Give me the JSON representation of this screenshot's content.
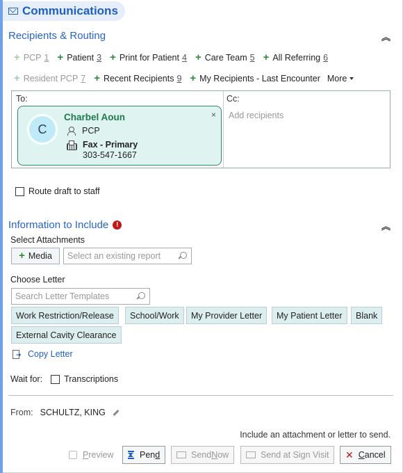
{
  "header": {
    "title": "Communications",
    "icon": "envelope-icon"
  },
  "recipients": {
    "section_title": "Recipients & Routing",
    "row1": [
      {
        "label": "PCP",
        "shortcut": "1",
        "enabled": false
      },
      {
        "label": "Patient",
        "shortcut": "3",
        "enabled": true
      },
      {
        "label": "Print for Patient",
        "shortcut": "4",
        "enabled": true
      },
      {
        "label": "Care Team",
        "shortcut": "5",
        "enabled": true
      },
      {
        "label": "All Referring",
        "shortcut": "6",
        "enabled": true
      }
    ],
    "row2": [
      {
        "label": "Resident PCP",
        "shortcut": "7",
        "enabled": false
      },
      {
        "label": "Recent Recipients",
        "shortcut": "9",
        "enabled": true
      },
      {
        "label": "My Recipients - Last Encounter",
        "shortcut": "",
        "enabled": true
      }
    ],
    "more_label": "More",
    "to_label": "To:",
    "cc_label": "Cc:",
    "cc_placeholder": "Add recipients",
    "card": {
      "initial": "C",
      "name": "Charbel Aoun",
      "role": "PCP",
      "method": "Fax - Primary",
      "number": "303-547-1667",
      "close": "×"
    },
    "route_draft_label": "Route draft to staff"
  },
  "info": {
    "section_title": "Information to Include",
    "alert": "!",
    "select_attachments_label": "Select Attachments",
    "media_label": "Media",
    "report_placeholder": "Select an existing report",
    "choose_letter_label": "Choose Letter",
    "letter_search_placeholder": "Search Letter Templates",
    "templates": [
      "Work Restriction/Release",
      "School/Work",
      "My Provider Letter",
      "My Patient Letter",
      "Blank",
      "External Cavity Clearance"
    ],
    "copy_letter_label": "Copy Letter",
    "wait_for_label": "Wait for:",
    "transcriptions_label": "Transcriptions"
  },
  "footer": {
    "from_label": "From:",
    "from_value": "SCHULTZ, KING",
    "hint": "Include an attachment or letter to send.",
    "buttons": {
      "preview_pre": "",
      "preview_u": "P",
      "preview_post": "review",
      "pend_pre": "Pen",
      "pend_u": "d",
      "pend_post": "",
      "send_now_pre": "Send ",
      "send_now_u": "N",
      "send_now_post": "ow",
      "send_sign": "Send at Sign Visit",
      "cancel_pre": "",
      "cancel_u": "C",
      "cancel_post": "ancel"
    }
  }
}
